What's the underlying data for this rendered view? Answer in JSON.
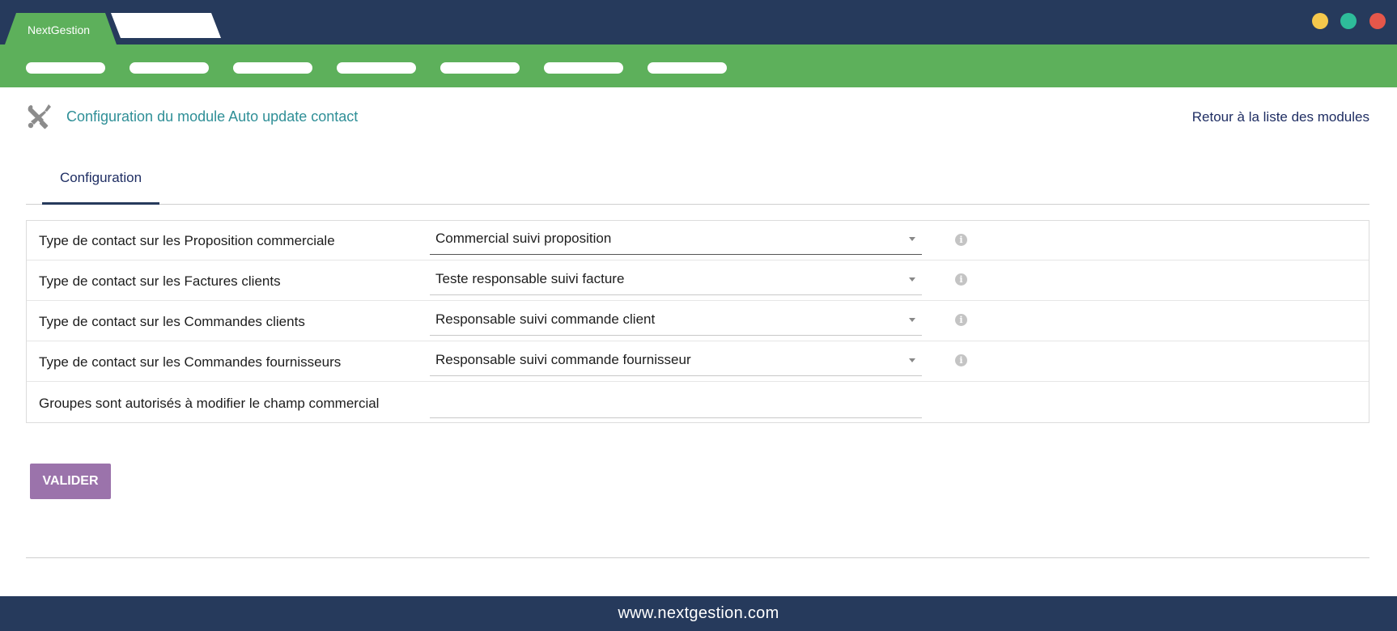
{
  "app": {
    "tab_label": "NextGestion"
  },
  "window_controls": {
    "colors": [
      "#f5c84c",
      "#2ebc9a",
      "#e5574a"
    ]
  },
  "colors": {
    "titlebar": "#263a5c",
    "navbar": "#5db05b",
    "title_text": "#2f8f97",
    "button": "#9b73ab"
  },
  "header": {
    "icon": "tools-icon",
    "title": "Configuration du module Auto update contact",
    "back_link": "Retour à la liste des modules"
  },
  "tabs": [
    {
      "label": "Configuration",
      "active": true
    }
  ],
  "form": {
    "rows": [
      {
        "label": "Type de contact sur les Proposition commerciale",
        "value": "Commercial suivi proposition",
        "has_info": true
      },
      {
        "label": "Type de contact sur les Factures clients",
        "value": "Teste responsable suivi facture",
        "has_info": true
      },
      {
        "label": "Type de contact sur les Commandes clients",
        "value": "Responsable suivi commande client",
        "has_info": true
      },
      {
        "label": "Type de contact sur les Commandes fournisseurs",
        "value": "Responsable suivi commande fournisseur",
        "has_info": true
      },
      {
        "label": "Groupes sont autorisés à modifier le champ commercial",
        "value": "",
        "has_info": false
      }
    ]
  },
  "actions": {
    "submit_label": "VALIDER"
  },
  "footer": {
    "text": "www.nextgestion.com"
  }
}
